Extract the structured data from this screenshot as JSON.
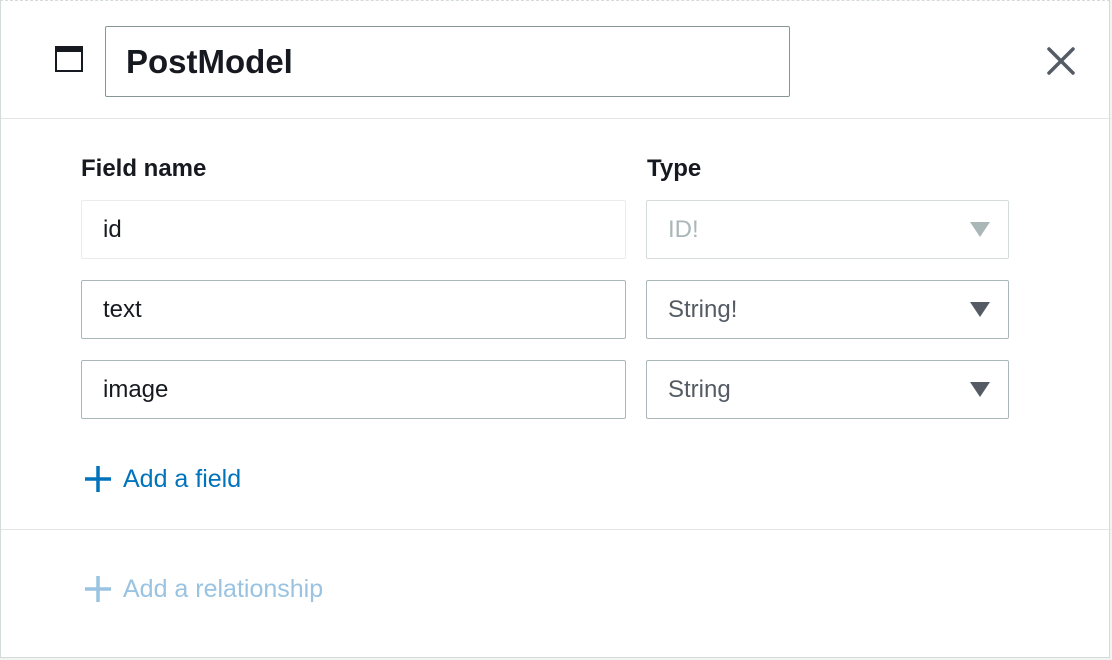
{
  "model": {
    "name": "PostModel"
  },
  "columns": {
    "field_name": "Field name",
    "type": "Type"
  },
  "fields": [
    {
      "name": "id",
      "type": "ID!",
      "locked": true
    },
    {
      "name": "text",
      "type": "String!",
      "locked": false
    },
    {
      "name": "image",
      "type": "String",
      "locked": false
    }
  ],
  "actions": {
    "add_field": "Add a field",
    "add_relationship": "Add a relationship"
  },
  "colors": {
    "link": "#0073bb",
    "link_disabled": "#99c3e1",
    "text": "#16191f"
  }
}
